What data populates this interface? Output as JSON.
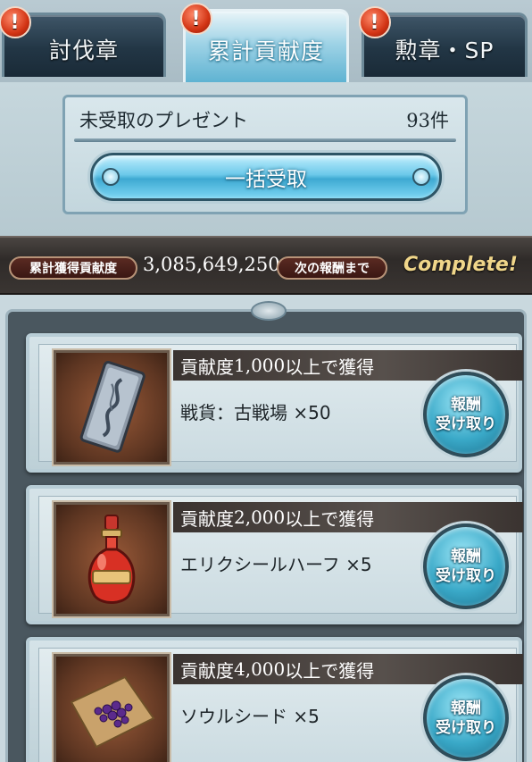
{
  "tabs": [
    {
      "label": "討伐章",
      "badge": "!",
      "active": false
    },
    {
      "label": "累計貢献度",
      "badge": "!",
      "active": true
    },
    {
      "label": "勲章・SP",
      "badge": "!",
      "active": false
    }
  ],
  "present": {
    "label": "未受取のプレゼント",
    "count": "93件",
    "bulk_button_label": "一括受取"
  },
  "status": {
    "total_label": "累計獲得貢献度",
    "total_value": "3,085,649,250",
    "next_label": "次の報酬まで",
    "next_value": "Complete!"
  },
  "rewards": [
    {
      "requirement_prefix": "貢献度",
      "requirement_value": "1,000",
      "requirement_suffix": "以上で獲得",
      "item": "戦貨：古戦場 ×50",
      "icon": "war-currency-plate-icon",
      "button_line1": "報酬",
      "button_line2": "受け取り"
    },
    {
      "requirement_prefix": "貢献度",
      "requirement_value": "2,000",
      "requirement_suffix": "以上で獲得",
      "item": "エリクシールハーフ ×5",
      "icon": "elixir-bottle-icon",
      "button_line1": "報酬",
      "button_line2": "受け取り"
    },
    {
      "requirement_prefix": "貢献度",
      "requirement_value": "4,000",
      "requirement_suffix": "以上で獲得",
      "item": "ソウルシード ×5",
      "icon": "soul-seed-icon",
      "button_line1": "報酬",
      "button_line2": "受け取り"
    }
  ],
  "colors": {
    "accent_blue": "#3ea9d2",
    "complete_gold": "#f0d68a",
    "badge_red": "#d23414"
  }
}
